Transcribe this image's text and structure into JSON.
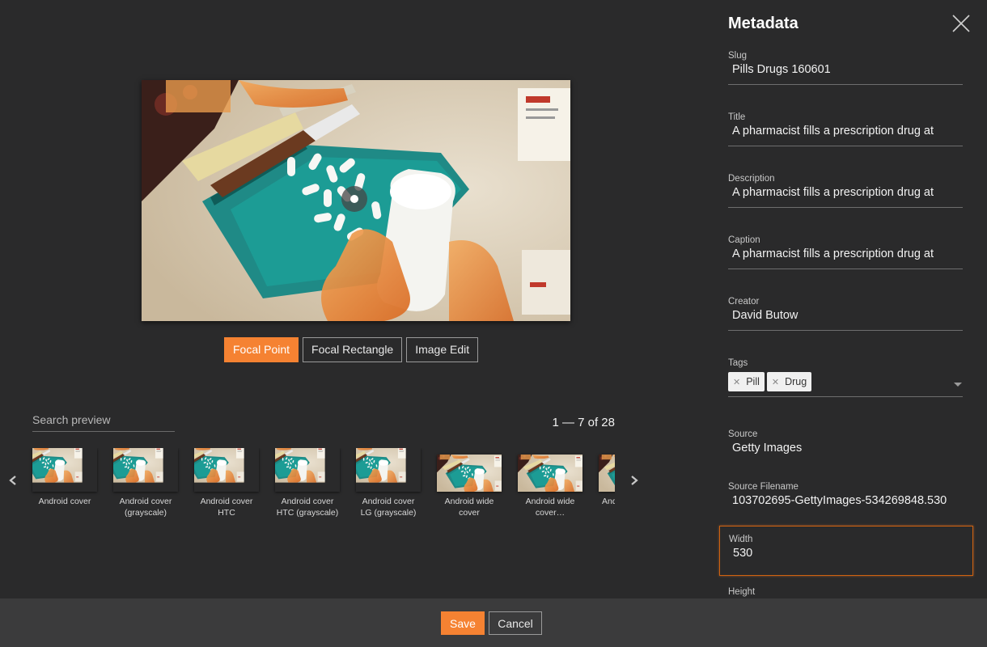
{
  "editor": {
    "modes": [
      "Focal Point",
      "Focal Rectangle",
      "Image Edit"
    ],
    "active_mode": "Focal Point"
  },
  "preview": {
    "search_placeholder": "Search preview",
    "pager": "1 — 7 of 28",
    "thumbnails": [
      {
        "label": "Android cover"
      },
      {
        "label": "Android cover\n(grayscale)"
      },
      {
        "label": "Android cover\nHTC"
      },
      {
        "label": "Android cover\nHTC (grayscale)"
      },
      {
        "label": "Android cover\nLG (grayscale)"
      },
      {
        "label": "Android wide\ncover"
      },
      {
        "label": "Android wide\ncover…"
      },
      {
        "label": "And"
      }
    ]
  },
  "footer": {
    "save_label": "Save",
    "cancel_label": "Cancel"
  },
  "metadata": {
    "title": "Metadata",
    "fields": {
      "slug": {
        "label": "Slug",
        "value": "Pills Drugs 160601"
      },
      "title": {
        "label": "Title",
        "value": "A pharmacist fills a prescription drug at"
      },
      "description": {
        "label": "Description",
        "value": "A pharmacist fills a prescription drug at"
      },
      "caption": {
        "label": "Caption",
        "value": "A pharmacist fills a prescription drug at"
      },
      "creator": {
        "label": "Creator",
        "value": "David Butow"
      },
      "tags": {
        "label": "Tags",
        "items": [
          "Pill",
          "Drug"
        ]
      },
      "source": {
        "label": "Source",
        "value": "Getty Images"
      },
      "source_filename": {
        "label": "Source Filename",
        "value": "103702695-GettyImages-534269848.530"
      },
      "width": {
        "label": "Width",
        "value": "530"
      },
      "height": {
        "label": "Height"
      }
    }
  },
  "colors": {
    "accent": "#f58232",
    "background": "#2a2a2b",
    "footer": "#3b3b3c"
  }
}
